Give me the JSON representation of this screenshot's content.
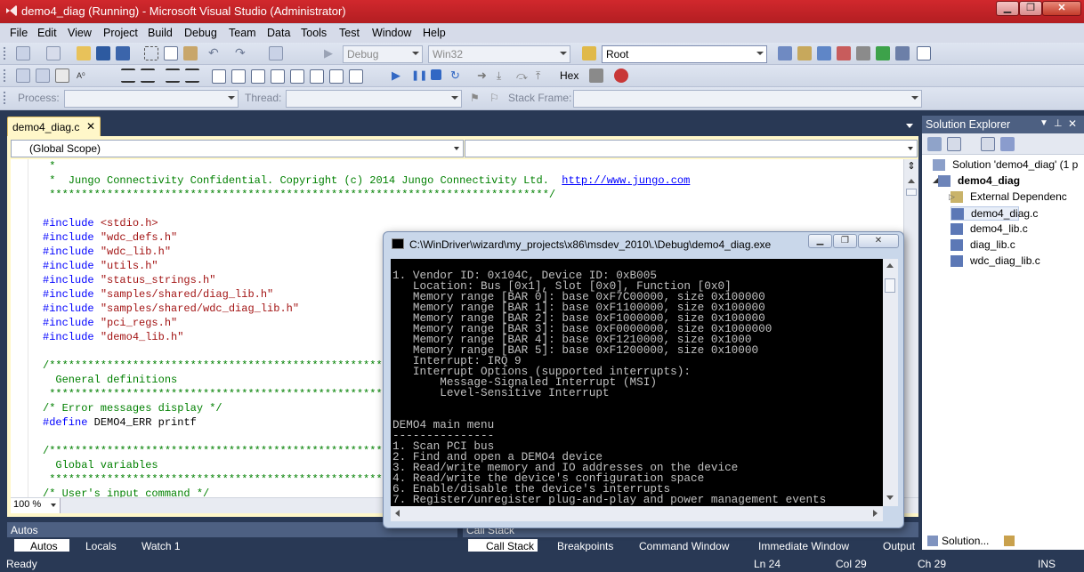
{
  "window": {
    "title": "demo4_diag (Running) - Microsoft Visual Studio (Administrator)"
  },
  "menu": [
    "File",
    "Edit",
    "View",
    "Project",
    "Build",
    "Debug",
    "Team",
    "Data",
    "Tools",
    "Test",
    "Window",
    "Help"
  ],
  "toolbar": {
    "config": "Debug",
    "platform": "Win32",
    "find_value": "Root",
    "hex_label": "Hex",
    "process_label": "Process:",
    "thread_label": "Thread:",
    "stackframe_label": "Stack Frame:"
  },
  "editor": {
    "tab": "demo4_diag.c",
    "scope": "(Global Scope)",
    "zoom": "100 %",
    "lines": [
      {
        "t": " *",
        "c": "c-cmt"
      },
      {
        "t": " *  Jungo Connectivity Confidential. Copyright (c) 2014 Jungo Connectivity Ltd.  ",
        "c": "c-cmt",
        "url": "http://www.jungo.com"
      },
      {
        "t": " ******************************************************************************/",
        "c": "c-cmt"
      },
      {
        "t": "",
        "c": ""
      },
      {
        "t": "#include <stdio.h>",
        "c": "inc"
      },
      {
        "t": "#include \"wdc_defs.h\"",
        "c": "inc"
      },
      {
        "t": "#include \"wdc_lib.h\"",
        "c": "inc"
      },
      {
        "t": "#include \"utils.h\"",
        "c": "inc"
      },
      {
        "t": "#include \"status_strings.h\"",
        "c": "inc"
      },
      {
        "t": "#include \"samples/shared/diag_lib.h\"",
        "c": "inc"
      },
      {
        "t": "#include \"samples/shared/wdc_diag_lib.h\"",
        "c": "inc"
      },
      {
        "t": "#include \"pci_regs.h\"",
        "c": "inc"
      },
      {
        "t": "#include \"demo4_lib.h\"",
        "c": "inc"
      },
      {
        "t": "",
        "c": ""
      },
      {
        "t": "/*************************************************************",
        "c": "c-cmt"
      },
      {
        "t": "  General definitions",
        "c": "c-cmt"
      },
      {
        "t": " *************************************************************",
        "c": "c-cmt"
      },
      {
        "t": "/* Error messages display */",
        "c": "c-cmt"
      },
      {
        "t": "#define DEMO4_ERR printf",
        "c": "def"
      },
      {
        "t": "",
        "c": ""
      },
      {
        "t": "/*************************************************************",
        "c": "c-cmt"
      },
      {
        "t": "  Global variables",
        "c": "c-cmt"
      },
      {
        "t": " *************************************************************",
        "c": "c-cmt"
      },
      {
        "t": "/* User's input command */",
        "c": "c-cmt"
      }
    ]
  },
  "solution_explorer": {
    "title": "Solution Explorer",
    "items": [
      {
        "label": "Solution 'demo4_diag' (1 p",
        "level": 0,
        "bold": false
      },
      {
        "label": "demo4_diag",
        "level": 1,
        "bold": true
      },
      {
        "label": "External Dependenc",
        "level": 2,
        "bold": false
      },
      {
        "label": "demo4_diag.c",
        "level": 2,
        "bold": false
      },
      {
        "label": "demo4_lib.c",
        "level": 2,
        "bold": false
      },
      {
        "label": "diag_lib.c",
        "level": 2,
        "bold": false
      },
      {
        "label": "wdc_diag_lib.c",
        "level": 2,
        "bold": false
      }
    ],
    "tabs": [
      "Solution...",
      "Team Ex..."
    ]
  },
  "bottom": {
    "autos_title": "Autos",
    "autos_tabs": [
      "Autos",
      "Locals",
      "Watch 1"
    ],
    "callstack_title": "Call Stack",
    "callstack_tabs": [
      "Call Stack",
      "Breakpoints",
      "Command Window",
      "Immediate Window",
      "Output"
    ]
  },
  "status": {
    "ready": "Ready",
    "ln": "Ln 24",
    "col": "Col 29",
    "ch": "Ch 29",
    "ins": "INS"
  },
  "console": {
    "title": "C:\\WinDriver\\wizard\\my_projects\\x86\\msdev_2010\\.\\Debug\\demo4_diag.exe",
    "lines": [
      "1. Vendor ID: 0x104C, Device ID: 0xB005",
      "   Location: Bus [0x1], Slot [0x0], Function [0x0]",
      "   Memory range [BAR 0]: base 0xF7C00000, size 0x100000",
      "   Memory range [BAR 1]: base 0xF1100000, size 0x100000",
      "   Memory range [BAR 2]: base 0xF1000000, size 0x100000",
      "   Memory range [BAR 3]: base 0xF0000000, size 0x1000000",
      "   Memory range [BAR 4]: base 0xF1210000, size 0x1000",
      "   Memory range [BAR 5]: base 0xF1200000, size 0x10000",
      "   Interrupt: IRQ 9",
      "   Interrupt Options (supported interrupts):",
      "       Message-Signaled Interrupt (MSI)",
      "       Level-Sensitive Interrupt",
      "",
      "",
      "DEMO4 main menu",
      "---------------",
      "1. Scan PCI bus",
      "2. Find and open a DEMO4 device",
      "3. Read/write memory and IO addresses on the device",
      "4. Read/write the device's configuration space",
      "6. Enable/disable the device's interrupts",
      "7. Register/unregister plug-and-play and power management events"
    ]
  },
  "colors": {
    "titlebar": "#c4262b",
    "vs_chrome": "#293955",
    "panel_header": "#4d6082",
    "editor_tab": "#fff7c9",
    "comment": "#008000",
    "keyword": "#0000ff",
    "string": "#a31515"
  }
}
